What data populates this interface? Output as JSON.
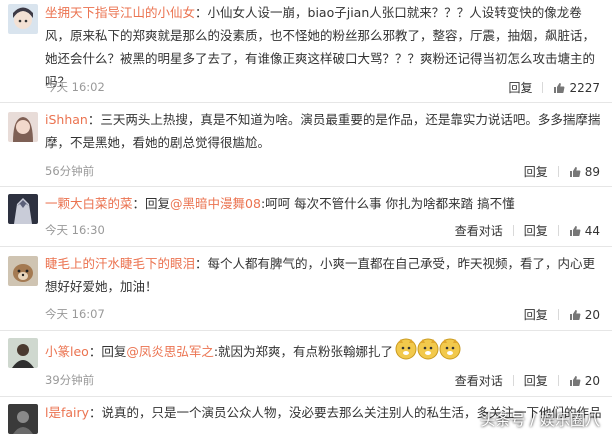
{
  "comments": [
    {
      "username": "坐拥天下指导江山的小仙女",
      "text": "：小仙女人设一崩，biao子jian人张口就来？？？人设转变快的像龙卷风，原来私下的郑爽就是那么的没素质，也不怪她的粉丝那么邪教了，整容，厅震，抽烟，飙脏话，她还会什么？被黑的明星多了去了，有谁像正爽这样破口大骂？？？爽粉还记得当初怎么攻击塘主的吗？",
      "time": "今天 16:02",
      "likes": "2227",
      "avatar_icon": "avatar-anime-girl-icon"
    },
    {
      "username": "iShhan",
      "text": "：三天两头上热搜，真是不知道为啥。演员最重要的是作品，还是靠实力说话吧。多多揣摩揣摩，不是黑她，看她的剧总觉得很尴尬。",
      "time": "56分钟前",
      "likes": "89",
      "avatar_icon": "avatar-girl-photo-icon"
    },
    {
      "username": "一颗大白菜的菜",
      "reply_prefix": "：回复",
      "mention": "@黑暗中漫舞08",
      "text": ":呵呵 每次不管什么事 你扎为啥都来踏 搞不懂",
      "time": "今天 16:30",
      "likes": "44",
      "avatar_icon": "avatar-anime-dark-icon"
    },
    {
      "username": "睫毛上的汗水睫毛下的眼泪",
      "text": "：每个人都有脾气的，小爽一直都在自己承受，昨天视频，看了，内心更想好好爱她，加油！",
      "time": "今天 16:07",
      "likes": "20",
      "avatar_icon": "avatar-dog-icon"
    },
    {
      "username": "小篆leo",
      "reply_prefix": "：回复",
      "mention": "@凤炎思弘军之",
      "text": ":就因为郑爽，有点粉张翰娜扎了",
      "time": "39分钟前",
      "likes": "20",
      "avatar_icon": "avatar-person-icon",
      "emoji_icon": "doge-emoji-icon"
    },
    {
      "username": "l是fairy",
      "text": "：说真的，只是一个演员公众人物，没必要去那么关注别人的私生活，多关注一下他们的作品就好。",
      "avatar_icon": "avatar-silhouette-icon"
    }
  ],
  "actions": {
    "reply_label": "回复",
    "view_conversation_label": "查看对话"
  },
  "watermark": "头条号 / 娱乐圈八"
}
